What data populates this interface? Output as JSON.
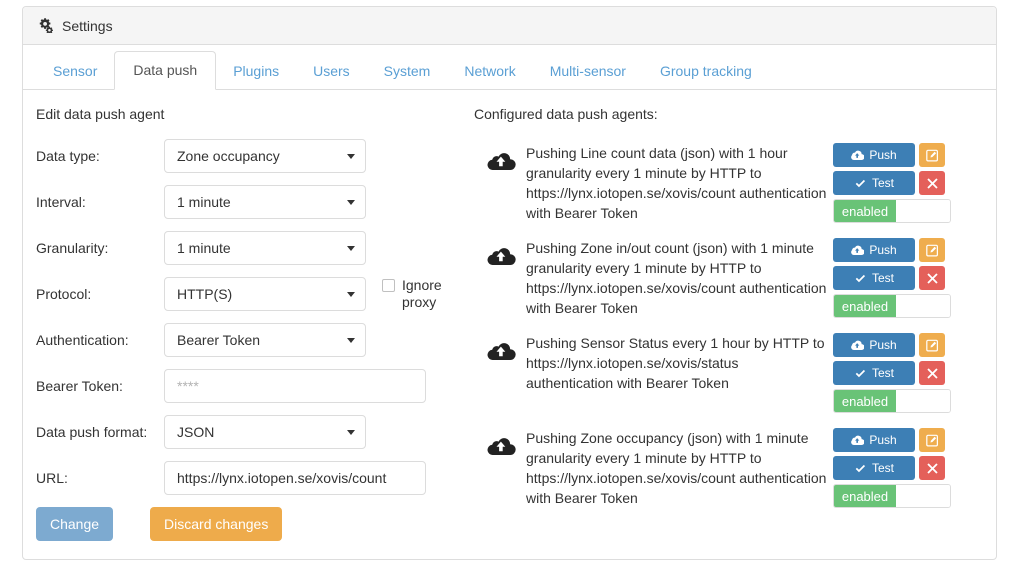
{
  "window": {
    "title": "Settings",
    "title_icon": "gears-icon"
  },
  "tabs": [
    {
      "label": "Sensor",
      "active": false
    },
    {
      "label": "Data push",
      "active": true
    },
    {
      "label": "Plugins",
      "active": false
    },
    {
      "label": "Users",
      "active": false
    },
    {
      "label": "System",
      "active": false
    },
    {
      "label": "Network",
      "active": false
    },
    {
      "label": "Multi-sensor",
      "active": false
    },
    {
      "label": "Group tracking",
      "active": false
    }
  ],
  "form": {
    "heading": "Edit data push agent",
    "fields": {
      "data_type": {
        "label": "Data type:",
        "value": "Zone occupancy",
        "caret_icon": "chevron-down-icon"
      },
      "interval": {
        "label": "Interval:",
        "value": "1 minute",
        "caret_icon": "chevron-down-icon"
      },
      "granularity": {
        "label": "Granularity:",
        "value": "1 minute",
        "caret_icon": "chevron-down-icon"
      },
      "protocol": {
        "label": "Protocol:",
        "value": "HTTP(S)",
        "caret_icon": "chevron-down-icon"
      },
      "auth": {
        "label": "Authentication:",
        "value": "Bearer Token",
        "caret_icon": "chevron-down-icon"
      },
      "bearer": {
        "label": "Bearer Token:",
        "value": "",
        "placeholder": "****"
      },
      "format": {
        "label": "Data push format:",
        "value": "JSON",
        "caret_icon": "chevron-down-icon"
      },
      "url": {
        "label": "URL:",
        "value": "https://lynx.iotopen.se/xovis/count",
        "placeholder": ""
      }
    },
    "ignore_proxy": {
      "label": "Ignore proxy",
      "checked": false
    },
    "buttons": {
      "change": "Change",
      "discard": "Discard changes"
    }
  },
  "agents_panel": {
    "heading": "Configured data push agents:",
    "action_labels": {
      "push": "Push",
      "test": "Test",
      "push_icon": "cloud-upload-icon",
      "test_icon": "check-icon",
      "edit_icon": "pencil-square-icon",
      "delete_icon": "close-icon",
      "state": "enabled"
    },
    "items": [
      {
        "icon": "cloud-upload-icon",
        "description": "Pushing Line count data (json) with 1 hour granularity every 1 minute by HTTP to https://lynx.iotopen.se/xovis/count authentication with Bearer Token",
        "push": "Push",
        "test": "Test",
        "state": "enabled"
      },
      {
        "icon": "cloud-upload-icon",
        "description": "Pushing Zone in/out count (json) with 1 minute granularity every 1 minute by HTTP to https://lynx.iotopen.se/xovis/count authentication with Bearer Token",
        "push": "Push",
        "test": "Test",
        "state": "enabled"
      },
      {
        "icon": "cloud-upload-icon",
        "description": "Pushing Sensor Status every 1 hour by HTTP to https://lynx.iotopen.se/xovis/status authentication with Bearer Token",
        "push": "Push",
        "test": "Test",
        "state": "enabled"
      },
      {
        "icon": "cloud-upload-icon",
        "description": "Pushing Zone occupancy (json) with 1 minute granularity every 1 minute by HTTP to https://lynx.iotopen.se/xovis/count authentication with Bearer Token",
        "push": "Push",
        "test": "Test",
        "state": "enabled"
      }
    ]
  },
  "colors": {
    "link": "#5a9fd4",
    "primary": "#3d7fb5",
    "warning": "#efad4e",
    "danger": "#e4605a",
    "success": "#69c377",
    "change_button": "#7daad0"
  }
}
